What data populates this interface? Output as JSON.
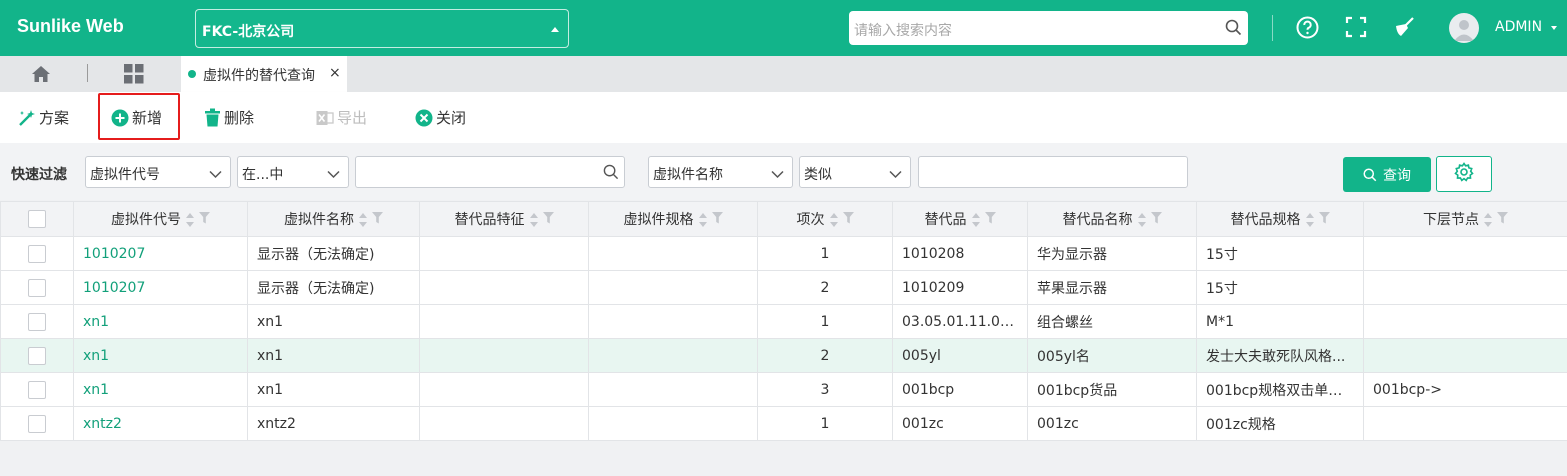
{
  "header": {
    "app_title": "Sunlike Web",
    "company": "FKC-北京公司",
    "search_placeholder": "请输入搜索内容",
    "user": "ADMIN",
    "brand_color": "#12b48a"
  },
  "tabs": {
    "home_icon": "home-icon",
    "grid_icon": "apps-grid-icon",
    "active_label": "虚拟件的替代查询",
    "close": "×"
  },
  "toolbar": {
    "scheme": "方案",
    "add": "新增",
    "delete": "删除",
    "export": "导出",
    "close": "关闭"
  },
  "filter": {
    "label": "快速过滤",
    "field1": "虚拟件代号",
    "op1": "在...中",
    "value1": "",
    "field2": "虚拟件名称",
    "op2": "类似",
    "value2": "",
    "query": "查询"
  },
  "table": {
    "columns": [
      "虚拟件代号",
      "虚拟件名称",
      "替代品特征",
      "虚拟件规格",
      "项次",
      "替代品",
      "替代品名称",
      "替代品规格",
      "下层节点"
    ],
    "rows": [
      [
        "1010207",
        "显示器（无法确定)",
        "",
        "",
        "1",
        "1010208",
        "华为显示器",
        "15寸",
        ""
      ],
      [
        "1010207",
        "显示器（无法确定)",
        "",
        "",
        "2",
        "1010209",
        "苹果显示器",
        "15寸",
        ""
      ],
      [
        "xn1",
        "xn1",
        "",
        "",
        "1",
        "03.05.01.11.00...",
        "组合螺丝",
        "M*1",
        ""
      ],
      [
        "xn1",
        "xn1",
        "",
        "",
        "2",
        "005yl",
        "005yl名",
        "发士大夫敢死队风格...",
        ""
      ],
      [
        "xn1",
        "xn1",
        "",
        "",
        "3",
        "001bcp",
        "001bcp货品",
        "001bcp规格双击单号...",
        "001bcp->"
      ],
      [
        "xntz2",
        "xntz2",
        "",
        "",
        "1",
        "001zc",
        "001zc",
        "001zc规格",
        ""
      ]
    ]
  }
}
